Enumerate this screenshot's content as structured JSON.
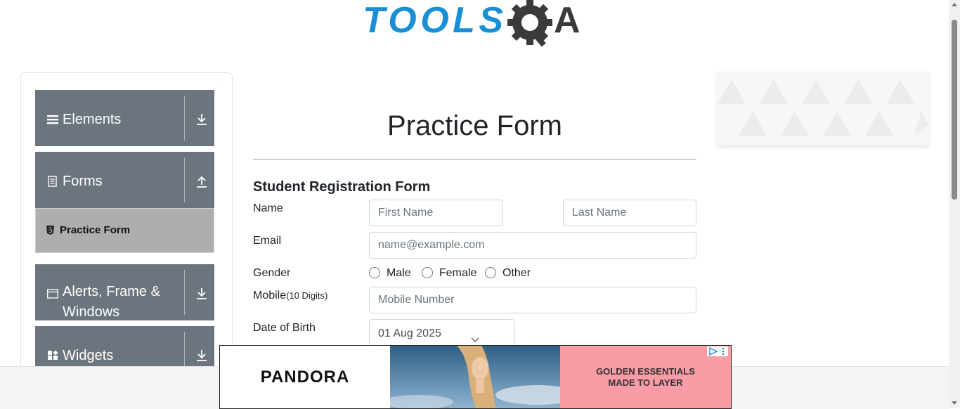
{
  "header": {
    "logo_icon": "toolsqa-logo",
    "logo_text_1": "TOOLS",
    "logo_text_2": "A"
  },
  "sidebar": {
    "groups": [
      {
        "label": "Elements",
        "icon": "hamburger-icon",
        "arrow": "download-arrow-icon"
      },
      {
        "label": "Forms",
        "icon": "document-icon",
        "arrow": "upload-arrow-icon"
      },
      {
        "label": "Alerts, Frame & Windows",
        "icon": "window-icon",
        "arrow": "download-arrow-icon"
      },
      {
        "label": "Widgets",
        "icon": "widgets-icon",
        "arrow": "download-arrow-icon"
      }
    ],
    "active_item": {
      "label": "Practice Form",
      "icon": "html5-icon"
    }
  },
  "main": {
    "title": "Practice Form",
    "form_title": "Student Registration Form",
    "name_label": "Name",
    "first_name_placeholder": "First Name",
    "last_name_placeholder": "Last Name",
    "email_label": "Email",
    "email_placeholder": "name@example.com",
    "gender_label": "Gender",
    "gender_options": [
      "Male",
      "Female",
      "Other"
    ],
    "mobile_label": "Mobile",
    "mobile_hint": "(10 Digits)",
    "mobile_placeholder": "Mobile Number",
    "dob_label": "Date of Birth",
    "dob_value": "01 Aug 2025"
  },
  "ad": {
    "brand": "PANDORA",
    "headline_1": "GOLDEN ESSENTIALS",
    "headline_2": "MADE TO LAYER"
  },
  "colors": {
    "sidebar_group_bg": "#6c757d",
    "active_item_bg": "#aeaeae",
    "logo_blue": "#1a8fd6",
    "logo_dark": "#333333",
    "ad_pink": "#f99ca6"
  }
}
